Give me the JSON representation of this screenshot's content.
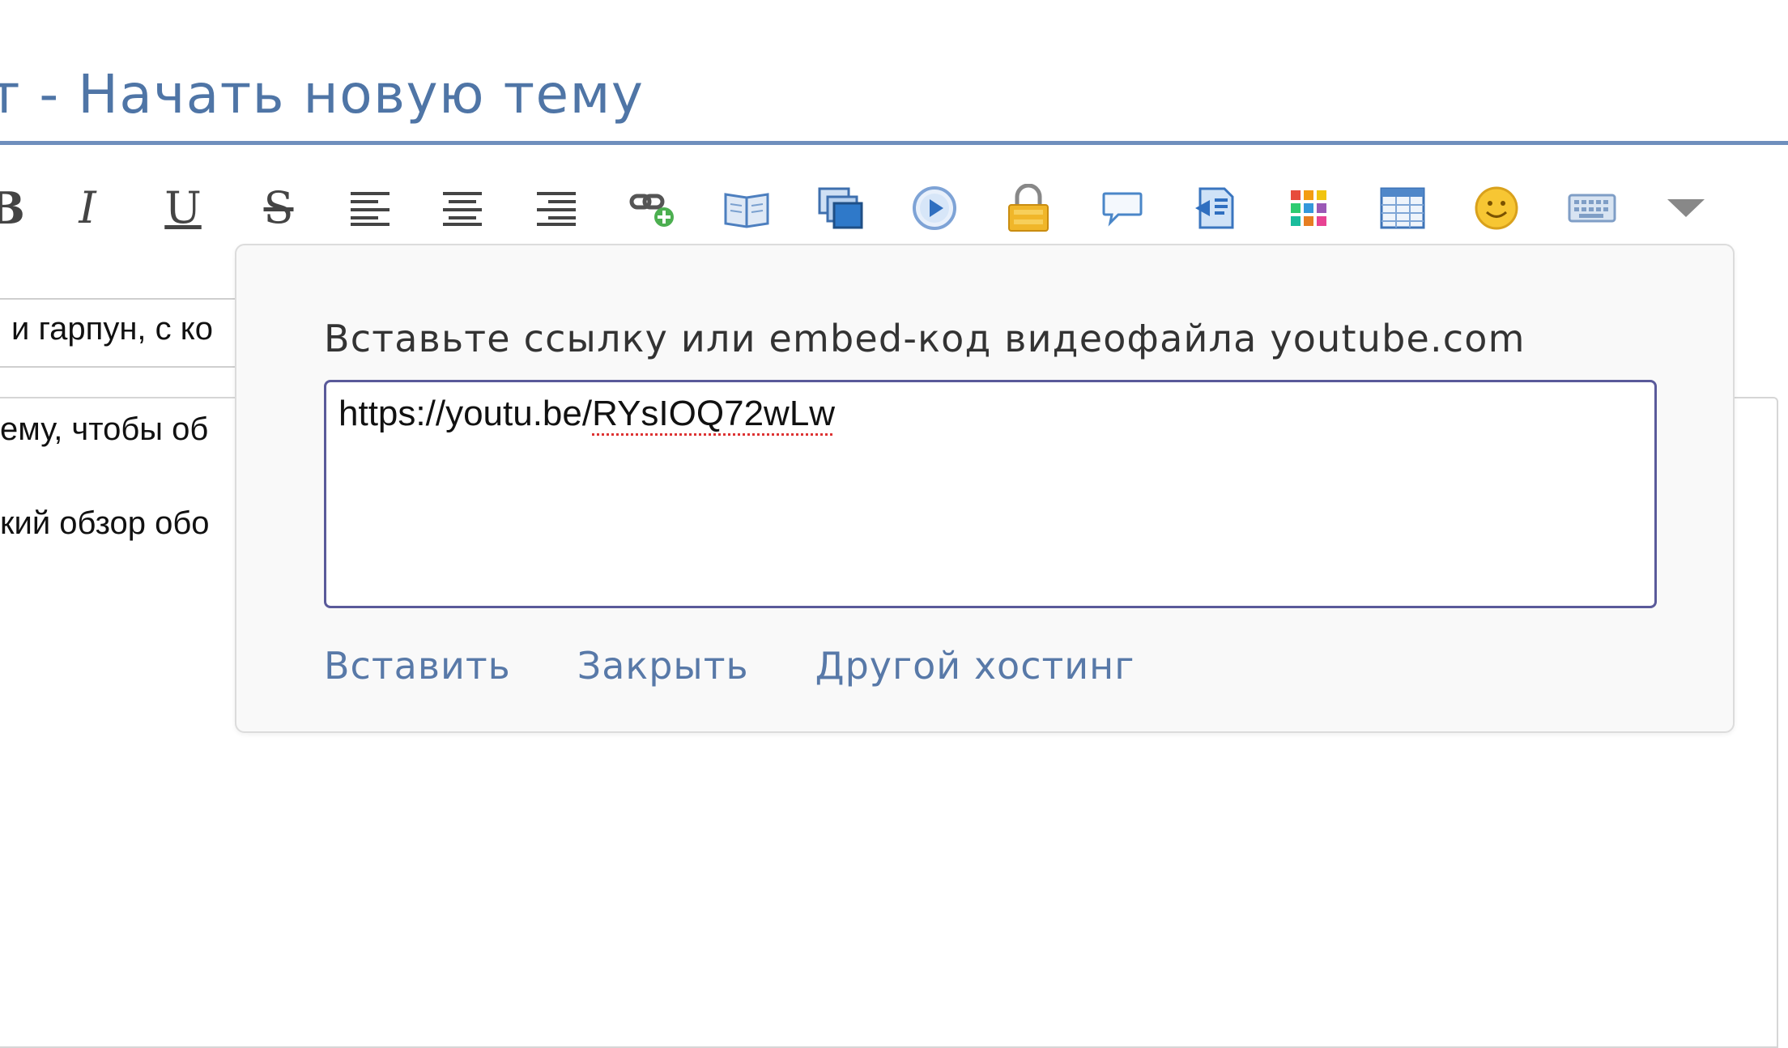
{
  "header": {
    "title": "т - Начать новую тему"
  },
  "toolbar": {
    "buttons": [
      {
        "name": "bold-icon",
        "glyph": "B"
      },
      {
        "name": "italic-icon",
        "glyph": "I"
      },
      {
        "name": "underline-icon",
        "glyph": "U"
      },
      {
        "name": "strikethrough-icon",
        "glyph": "S"
      },
      {
        "name": "align-left-icon"
      },
      {
        "name": "align-center-icon"
      },
      {
        "name": "align-right-icon"
      },
      {
        "name": "insert-link-icon"
      },
      {
        "name": "book-icon"
      },
      {
        "name": "gallery-icon"
      },
      {
        "name": "video-play-icon"
      },
      {
        "name": "lock-icon"
      },
      {
        "name": "speech-bubble-icon"
      },
      {
        "name": "code-icon"
      },
      {
        "name": "color-grid-icon"
      },
      {
        "name": "table-icon"
      },
      {
        "name": "smiley-icon"
      },
      {
        "name": "keyboard-icon"
      },
      {
        "name": "dropdown-arrow-icon"
      }
    ]
  },
  "editor": {
    "subject_text": "и гарпун, с ко",
    "body_lines": [
      "ему, чтобы об",
      "кий обзор обо"
    ]
  },
  "video_popup": {
    "label": "Вставьте ссылку или embed-код видеофайла youtube.com",
    "input_prefix": "https://youtu.be/",
    "input_id_part": "RYsIOQ72wLw",
    "insert_label": "Вставить",
    "close_label": "Закрыть",
    "other_hosting_label": "Другой хостинг"
  },
  "colors": {
    "accent": "#4f75a6",
    "link": "#5879a8",
    "input_border": "#5a5a9a"
  }
}
